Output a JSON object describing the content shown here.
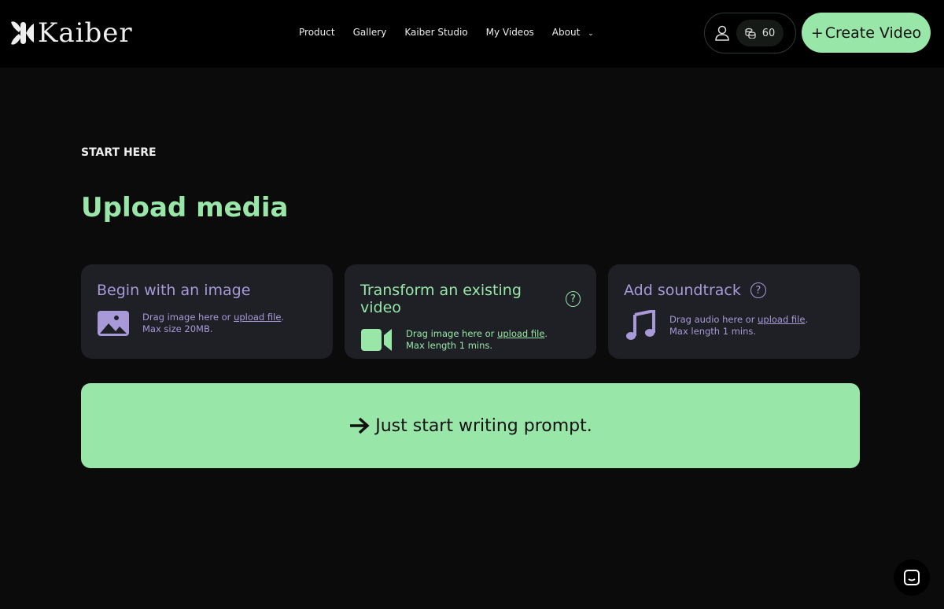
{
  "header": {
    "logo": "Kaiber",
    "nav": [
      "Product",
      "Gallery",
      "Kaiber Studio",
      "My Videos",
      "About"
    ],
    "credits": "60",
    "create_label": "Create Video"
  },
  "main": {
    "eyebrow": "START HERE",
    "title": "Upload media",
    "cards": [
      {
        "title": "Begin with an image",
        "drag": "Drag image here or ",
        "link": "upload file",
        "period": ".",
        "limit": "Max size 20MB."
      },
      {
        "title": "Transform an existing video",
        "drag": "Drag image here or ",
        "link": "upload file",
        "period": ".",
        "limit": "Max length 1 mins."
      },
      {
        "title": "Add soundtrack",
        "drag": "Drag audio here or ",
        "link": "upload file",
        "period": ".",
        "limit": "Max length 1 mins."
      }
    ],
    "prompt_label": "Just start writing prompt."
  },
  "colors": {
    "accent": "#98e6a8",
    "purple": "#a899d8",
    "card": "#1f2026"
  }
}
